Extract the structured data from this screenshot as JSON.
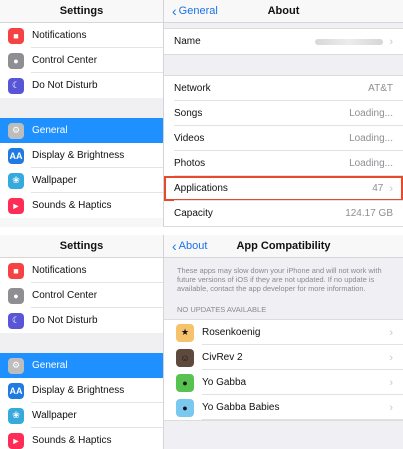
{
  "top": {
    "sidebar": {
      "title": "Settings",
      "items": [
        {
          "label": "Notifications",
          "icon": "notifications-icon"
        },
        {
          "label": "Control Center",
          "icon": "control-center-icon"
        },
        {
          "label": "Do Not Disturb",
          "icon": "do-not-disturb-icon"
        },
        {
          "label": "General",
          "icon": "gear-icon",
          "selected": true
        },
        {
          "label": "Display & Brightness",
          "icon": "display-icon"
        },
        {
          "label": "Wallpaper",
          "icon": "wallpaper-icon"
        },
        {
          "label": "Sounds & Haptics",
          "icon": "sounds-icon"
        }
      ]
    },
    "main": {
      "back_label": "General",
      "title": "About",
      "name_label": "Name",
      "rows": [
        {
          "label": "Network",
          "value": "AT&T"
        },
        {
          "label": "Songs",
          "value": "Loading..."
        },
        {
          "label": "Videos",
          "value": "Loading..."
        },
        {
          "label": "Photos",
          "value": "Loading..."
        },
        {
          "label": "Applications",
          "value": "47"
        },
        {
          "label": "Capacity",
          "value": "124.17 GB"
        }
      ]
    }
  },
  "bottom": {
    "sidebar": {
      "title": "Settings",
      "items": [
        {
          "label": "Notifications"
        },
        {
          "label": "Control Center"
        },
        {
          "label": "Do Not Disturb"
        },
        {
          "label": "General"
        },
        {
          "label": "Display & Brightness"
        },
        {
          "label": "Wallpaper"
        },
        {
          "label": "Sounds & Haptics"
        }
      ]
    },
    "main": {
      "back_label": "About",
      "title": "App Compatibility",
      "description": "These apps may slow down your iPhone and will not work with future versions of iOS if they are not updated. If no update is available, contact the app developer for more information.",
      "section_header": "NO UPDATES AVAILABLE",
      "apps": [
        {
          "name": "Rosenkoenig"
        },
        {
          "name": "CivRev 2"
        },
        {
          "name": "Yo Gabba"
        },
        {
          "name": "Yo Gabba Babies"
        }
      ]
    }
  },
  "colors": {
    "accent": "#1e90ff",
    "link": "#1a73e8",
    "highlight": "#e64a2b"
  }
}
